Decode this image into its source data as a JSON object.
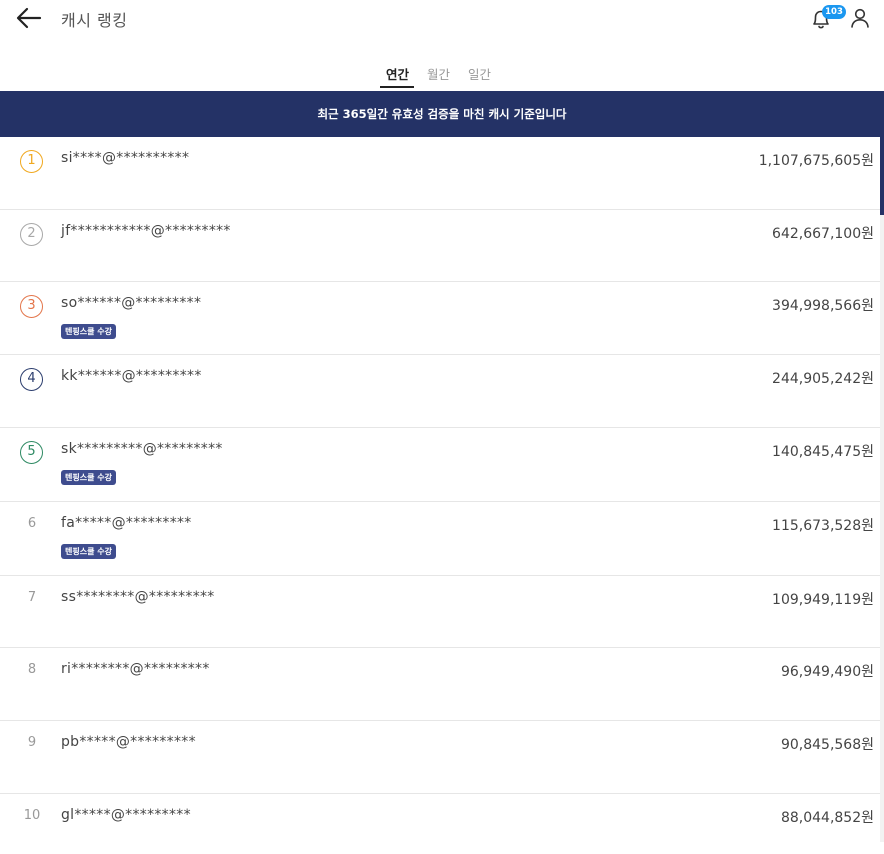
{
  "header": {
    "title": "캐시 랭킹",
    "notification_count": "103",
    "icons": {
      "back": "arrow-left-icon",
      "bell": "bell-icon",
      "user": "user-icon"
    }
  },
  "tabs": [
    {
      "label": "연간",
      "active": true
    },
    {
      "label": "월간",
      "active": false
    },
    {
      "label": "일간",
      "active": false
    }
  ],
  "banner": {
    "text": "최근 365일간 유효성 검증을 마친 캐시 기준입니다"
  },
  "rankings": [
    {
      "rank": "1",
      "user": "si****@**********",
      "amount": "1,107,675,605원",
      "tag": ""
    },
    {
      "rank": "2",
      "user": "jf***********@*********",
      "amount": "642,667,100원",
      "tag": ""
    },
    {
      "rank": "3",
      "user": "so******@*********",
      "amount": "394,998,566원",
      "tag": "텐핑스쿨 수강"
    },
    {
      "rank": "4",
      "user": "kk******@*********",
      "amount": "244,905,242원",
      "tag": ""
    },
    {
      "rank": "5",
      "user": "sk*********@*********",
      "amount": "140,845,475원",
      "tag": "텐핑스쿨 수강"
    },
    {
      "rank": "6",
      "user": "fa*****@*********",
      "amount": "115,673,528원",
      "tag": "텐핑스쿨 수강"
    },
    {
      "rank": "7",
      "user": "ss********@*********",
      "amount": "109,949,119원",
      "tag": ""
    },
    {
      "rank": "8",
      "user": "ri********@*********",
      "amount": "96,949,490원",
      "tag": ""
    },
    {
      "rank": "9",
      "user": "pb*****@*********",
      "amount": "90,845,568원",
      "tag": ""
    },
    {
      "rank": "10",
      "user": "gl*****@*********",
      "amount": "88,044,852원",
      "tag": ""
    }
  ],
  "colors": {
    "banner_bg": "#243266",
    "rank1": "#f0a81f",
    "rank2": "#a8a8a8",
    "rank3": "#e3754a",
    "rank4": "#2c3e6e",
    "rank5": "#2e8a63",
    "tag_bg": "#3e4c8e",
    "badge_bg": "#1b97f0"
  }
}
